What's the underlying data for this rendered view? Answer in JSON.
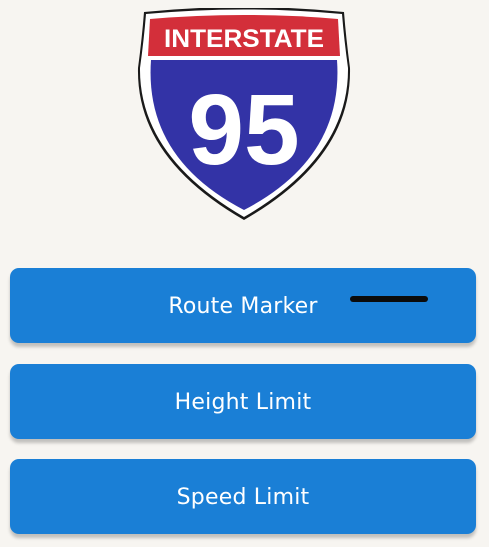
{
  "sign": {
    "icon": "interstate-shield-icon",
    "banner_text": "INTERSTATE",
    "route_number": "95",
    "banner_color": "#d32f3a",
    "body_color": "#3333a6",
    "outline_color": "#ffffff"
  },
  "options": [
    {
      "label": "Route Marker"
    },
    {
      "label": "Height Limit"
    },
    {
      "label": "Speed Limit"
    }
  ],
  "colors": {
    "background": "#f7f5f1",
    "button": "#1a7fd6"
  }
}
